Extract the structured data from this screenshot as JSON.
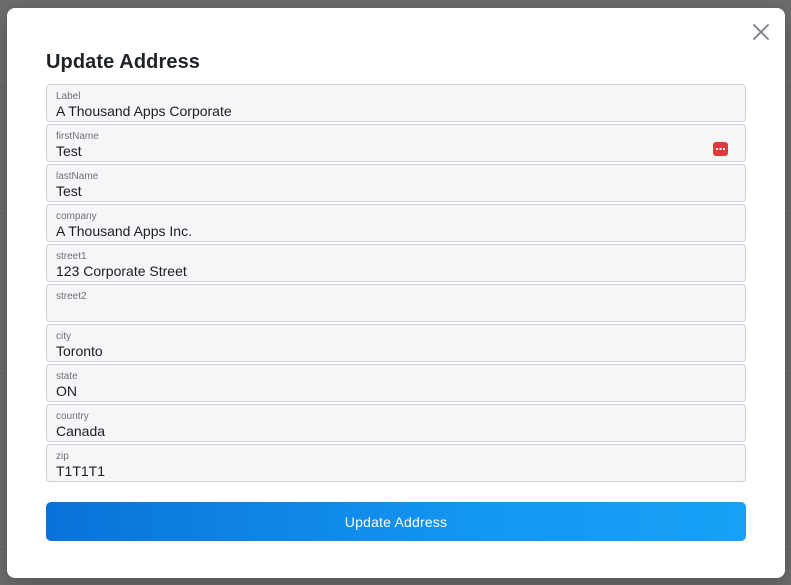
{
  "modal": {
    "title": "Update Address",
    "submit_label": "Update Address",
    "fields": [
      {
        "label": "Label",
        "value": "A Thousand Apps Corporate"
      },
      {
        "label": "firstName",
        "value": "Test"
      },
      {
        "label": "lastName",
        "value": "Test"
      },
      {
        "label": "company",
        "value": "A Thousand Apps Inc."
      },
      {
        "label": "street1",
        "value": "123 Corporate Street"
      },
      {
        "label": "street2",
        "value": ""
      },
      {
        "label": "city",
        "value": "Toronto"
      },
      {
        "label": "state",
        "value": "ON"
      },
      {
        "label": "country",
        "value": "Canada"
      },
      {
        "label": "zip",
        "value": "T1T1T1"
      }
    ]
  },
  "icons": {
    "close": "close-icon",
    "password_manager": "password-manager-icon"
  },
  "colors": {
    "primary_button": "#0a72d8",
    "primary_button_end": "#17a1f7",
    "field_background": "#f6f6f9",
    "field_border": "#cfd1d6",
    "password_icon": "#e23a3a"
  }
}
